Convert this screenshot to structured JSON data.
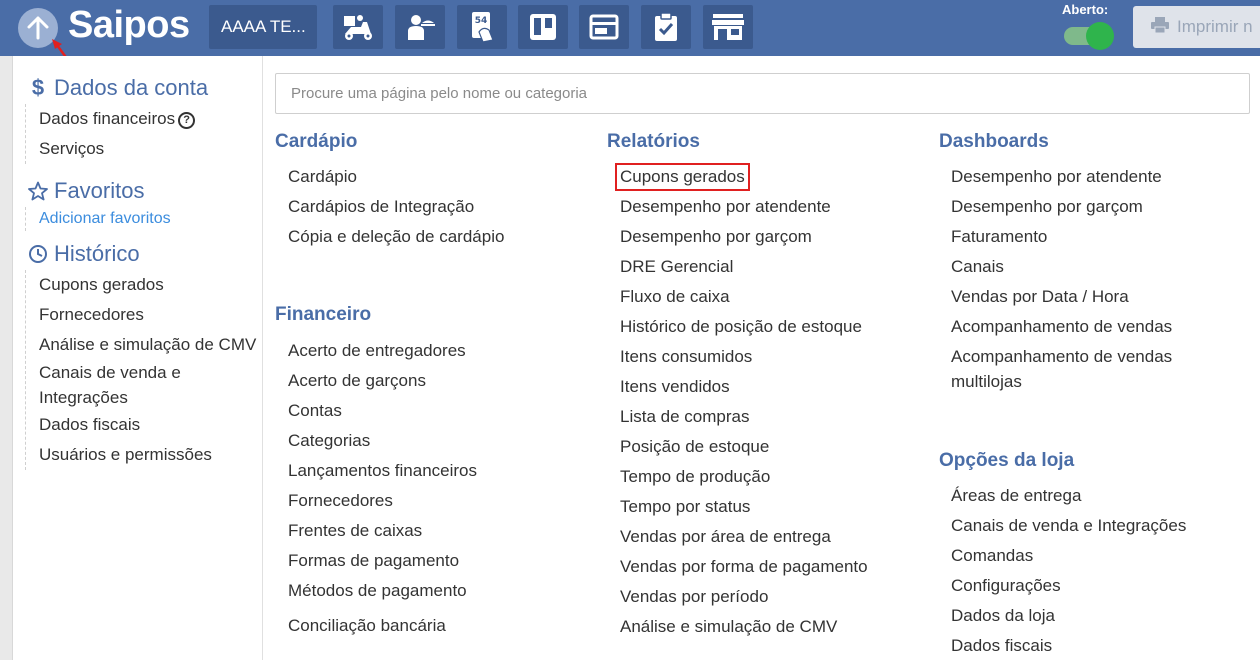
{
  "header": {
    "logo": "Saipos",
    "store_name": "AAAA TE...",
    "tools": [
      "delivery-icon",
      "waiter-icon",
      "table-card-icon",
      "kanban-icon",
      "panel-icon",
      "checklist-icon",
      "store-icon"
    ],
    "open_label": "Aberto:",
    "print_label": "Imprimir n",
    "accent": "#4a6da7",
    "toggle_on_color": "#2fb44c"
  },
  "sidebar": {
    "account": {
      "title": "Dados da conta",
      "items": [
        "Dados financeiros",
        "Serviços"
      ]
    },
    "favorites": {
      "title": "Favoritos",
      "add_link": "Adicionar favoritos"
    },
    "history": {
      "title": "Histórico",
      "items": [
        "Cupons gerados",
        "Fornecedores",
        "Análise e simulação de CMV",
        "Canais de venda e Integrações",
        "Dados fiscais",
        "Usuários e permissões"
      ]
    }
  },
  "search": {
    "placeholder": "Procure uma página pelo nome ou categoria"
  },
  "columns": {
    "cardapio": {
      "title": "Cardápio",
      "items": [
        "Cardápio",
        "Cardápios de Integração",
        "Cópia e deleção de cardápio"
      ]
    },
    "financeiro": {
      "title": "Financeiro",
      "items": [
        "Acerto de entregadores",
        "Acerto de garçons",
        "Contas",
        "Categorias",
        "Lançamentos financeiros",
        "Fornecedores",
        "Frentes de caixas",
        "Formas de pagamento",
        "Métodos de pagamento",
        "Conciliação bancária"
      ]
    },
    "relatorios": {
      "title": "Relatórios",
      "items": [
        "Cupons gerados",
        "Desempenho por atendente",
        "Desempenho por garçom",
        "DRE Gerencial",
        "Fluxo de caixa",
        "Histórico de posição de estoque",
        "Itens consumidos",
        "Itens vendidos",
        "Lista de compras",
        "Posição de estoque",
        "Tempo de produção",
        "Tempo por status",
        "Vendas por área de entrega",
        "Vendas por forma de pagamento",
        "Vendas por período",
        "Análise e simulação de CMV"
      ]
    },
    "dashboards": {
      "title": "Dashboards",
      "items": [
        "Desempenho por atendente",
        "Desempenho por garçom",
        "Faturamento",
        "Canais",
        "Vendas por Data / Hora",
        "Acompanhamento de vendas",
        "Acompanhamento de vendas multilojas"
      ]
    },
    "opcoes": {
      "title": "Opções da loja",
      "items": [
        "Áreas de entrega",
        "Canais de venda e Integrações",
        "Comandas",
        "Configurações",
        "Dados da loja",
        "Dados fiscais"
      ]
    }
  }
}
